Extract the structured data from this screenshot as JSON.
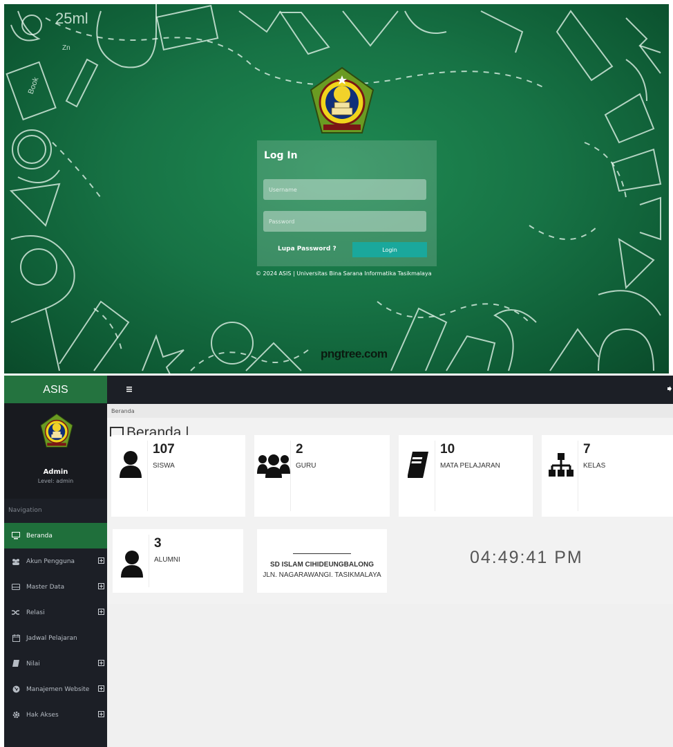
{
  "login": {
    "title": "Log In",
    "username_placeholder": "Username",
    "password_placeholder": "Password",
    "forgot_label": "Lupa Password ?",
    "login_button": "Login",
    "copyright": "© 2024 ASIS | Universitas Bina Sarana Informatika Tasikmalaya",
    "watermark": "pngtree.com",
    "doodle_texts": {
      "volume": "25ml",
      "book": "Book",
      "zn": "Zn"
    }
  },
  "dashboard": {
    "brand": "ASIS",
    "user": {
      "name": "Admin",
      "level": "Level: admin"
    },
    "nav_header": "Navigation",
    "menu": [
      {
        "label": "Beranda",
        "icon": "monitor-icon",
        "active": true,
        "expandable": false
      },
      {
        "label": "Akun Pengguna",
        "icon": "users-icon",
        "active": false,
        "expandable": true
      },
      {
        "label": "Master Data",
        "icon": "hdd-icon",
        "active": false,
        "expandable": true
      },
      {
        "label": "Relasi",
        "icon": "shuffle-icon",
        "active": false,
        "expandable": true
      },
      {
        "label": "Jadwal Pelajaran",
        "icon": "calendar-icon",
        "active": false,
        "expandable": false
      },
      {
        "label": "Nilai",
        "icon": "book-icon",
        "active": false,
        "expandable": true
      },
      {
        "label": "Manajemen Website",
        "icon": "globe-icon",
        "active": false,
        "expandable": true
      },
      {
        "label": "Hak Akses",
        "icon": "gear-icon",
        "active": false,
        "expandable": true
      }
    ],
    "breadcrumb": "Beranda",
    "page_title": "Beranda |",
    "stats": [
      {
        "value": "107",
        "label": "SISWA",
        "icon": "user-icon"
      },
      {
        "value": "2",
        "label": "GURU",
        "icon": "group-icon"
      },
      {
        "value": "10",
        "label": "MATA PELAJARAN",
        "icon": "book-icon"
      },
      {
        "value": "7",
        "label": "KELAS",
        "icon": "sitemap-icon"
      },
      {
        "value": "3",
        "label": "ALUMNI",
        "icon": "user-icon"
      }
    ],
    "school": {
      "name": "SD ISLAM CIHIDEUNGBALONG",
      "address": "JLN. NAGARAWANGI. TASIKMALAYA"
    },
    "clock": "04:49:41 PM"
  },
  "colors": {
    "chalkboard": "#177345",
    "sidebar": "#1c1f26",
    "brand_green": "#24733f",
    "login_button": "#1aa89c"
  }
}
